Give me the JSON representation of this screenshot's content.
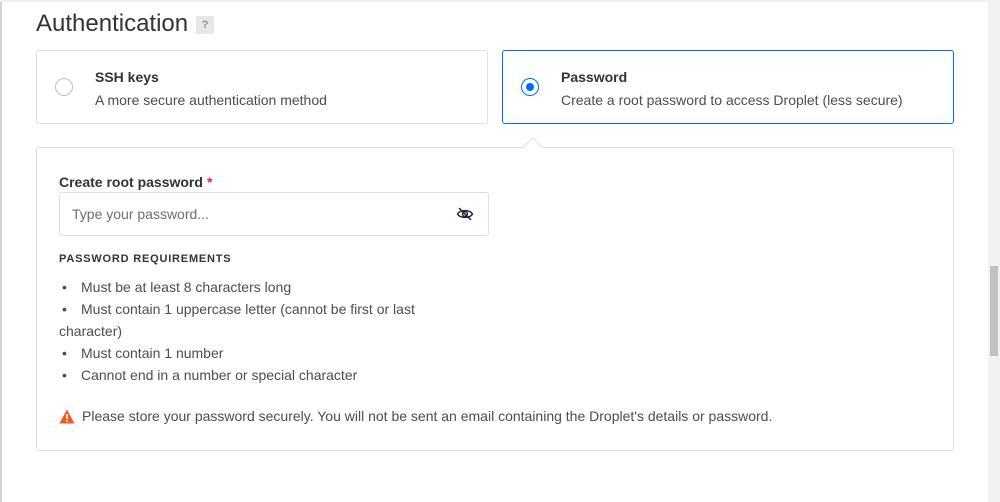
{
  "section": {
    "title": "Authentication",
    "help_label": "?"
  },
  "options": [
    {
      "title": "SSH keys",
      "description": "A more secure authentication method",
      "selected": false
    },
    {
      "title": "Password",
      "description": "Create a root password to access Droplet (less secure)",
      "selected": true
    }
  ],
  "password_panel": {
    "label": "Create root password",
    "required_marker": "*",
    "input_placeholder": "Type your password...",
    "input_value": "",
    "requirements_heading": "PASSWORD REQUIREMENTS",
    "requirements": [
      "Must be at least 8 characters long",
      "Must contain 1 uppercase letter (cannot be first or last",
      "character)",
      "Must contain 1 number",
      "Cannot end in a number or special character"
    ],
    "warning": "Please store your password securely. You will not be sent an email containing the Droplet's details or password."
  },
  "colors": {
    "accent": "#0069ff",
    "warning": "#f15a22",
    "required": "#e0245e"
  }
}
